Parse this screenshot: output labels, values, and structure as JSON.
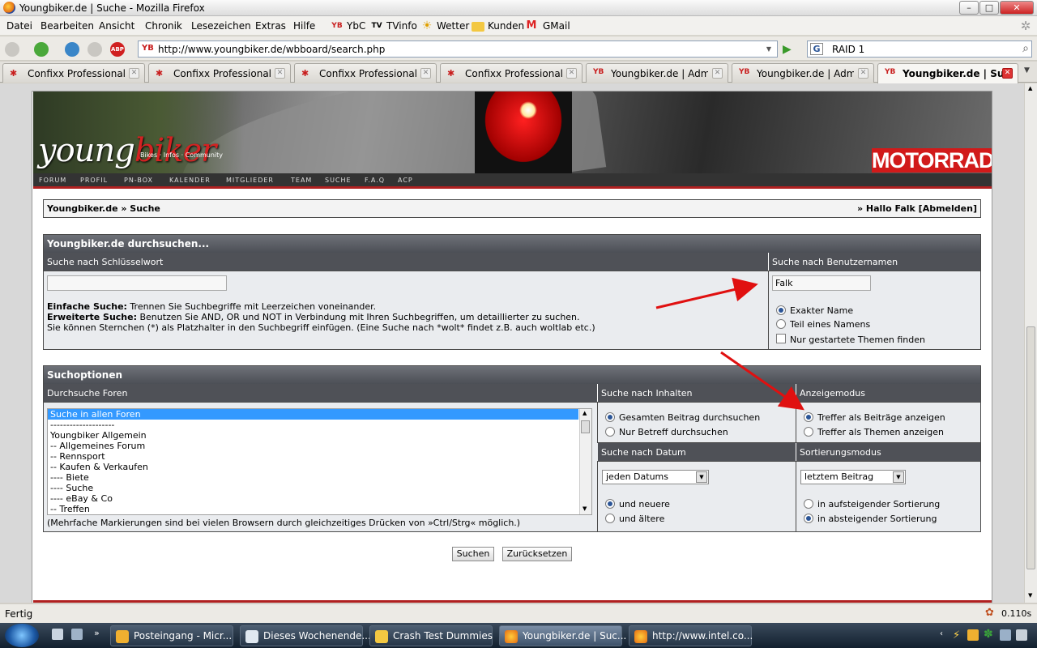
{
  "window": {
    "title": "Youngbiker.de | Suche - Mozilla Firefox"
  },
  "menu": {
    "items": [
      "Datei",
      "Bearbeiten",
      "Ansicht",
      "Chronik",
      "Lesezeichen",
      "Extras",
      "Hilfe"
    ],
    "bookmarks": [
      "YbC",
      "TVinfo",
      "Wetter",
      "Kunden",
      "GMail"
    ]
  },
  "nav": {
    "url": "http://www.youngbiker.de/wbboard/search.php",
    "search_value": "RAID 1"
  },
  "tabs": [
    {
      "label": "Confixx Professional"
    },
    {
      "label": "Confixx Professional"
    },
    {
      "label": "Confixx Professional"
    },
    {
      "label": "Confixx Professional"
    },
    {
      "label": "Youngbiker.de | Admi..."
    },
    {
      "label": "Youngbiker.de | Admi..."
    },
    {
      "label": "Youngbiker.de | Suche"
    }
  ],
  "site": {
    "logo_text": "young",
    "logo_red": "biker",
    "slogan": "Bikes · Infos · Community",
    "brand": "MOTORRAD",
    "nav": [
      "FORUM",
      "PROFIL",
      "PN-BOX",
      "KALENDER",
      "MITGLIEDER",
      "TEAM",
      "SUCHE",
      "F.A.Q",
      "ACP"
    ]
  },
  "breadcrumb": {
    "left": "Youngbiker.de » Suche",
    "right": "» Hallo Falk [Abmelden]"
  },
  "search": {
    "title": "Youngbiker.de durchsuchen...",
    "keyword_header": "Suche nach Schlüsselwort",
    "user_header": "Suche nach Benutzernamen",
    "keyword_value": "",
    "user_value": "Falk",
    "help_simple_b": "Einfache Suche:",
    "help_simple": " Trennen Sie Suchbegriffe mit Leerzeichen voneinander.",
    "help_adv_b": "Erweiterte Suche:",
    "help_adv": " Benutzen Sie AND, OR und NOT in Verbindung mit Ihren Suchbegriffen, um detaillierter zu suchen.",
    "help_star": "Sie können Sternchen (*) als Platzhalter in den Suchbegriff einfügen. (Eine Suche nach *wolt* findet z.B. auch woltlab etc.)",
    "exact": "Exakter Name",
    "partial": "Teil eines Namens",
    "started": "Nur gestartete Themen finden"
  },
  "options": {
    "title": "Suchoptionen",
    "forums_header": "Durchsuche Foren",
    "content_header": "Suche nach Inhalten",
    "mode_header": "Anzeigemodus",
    "date_header": "Suche nach Datum",
    "sort_header": "Sortierungsmodus",
    "forums": [
      "Suche in allen Foren",
      "--------------------",
      "Youngbiker Allgemein",
      "-- Allgemeines Forum",
      "-- Rennsport",
      "-- Kaufen & Verkaufen",
      "---- Biete",
      "---- Suche",
      "---- eBay & Co",
      "-- Treffen"
    ],
    "forums_hint": "(Mehrfache Markierungen sind bei vielen Browsern durch gleichzeitiges Drücken von »Ctrl/Strg« möglich.)",
    "content_full": "Gesamten Beitrag durchsuchen",
    "content_subject": "Nur Betreff durchsuchen",
    "mode_posts": "Treffer als Beiträge anzeigen",
    "mode_threads": "Treffer als Themen anzeigen",
    "date_select": "jeden Datums",
    "date_newer": "und neuere",
    "date_older": "und ältere",
    "sort_select": "letztem Beitrag",
    "sort_asc": "in aufsteigender Sortierung",
    "sort_desc": "in absteigender Sortierung",
    "submit": "Suchen",
    "reset": "Zurücksetzen"
  },
  "status": {
    "text": "Fertig",
    "time": "0.110s"
  },
  "taskbar": {
    "items": [
      "Posteingang - Micr...",
      "Dieses Wochenende...",
      "Crash Test Dummies",
      "Youngbiker.de | Suc...",
      "http://www.intel.co..."
    ]
  },
  "colors": {
    "accent": "#2b5597",
    "header": "#4f5157",
    "arrow": "#e01010"
  }
}
